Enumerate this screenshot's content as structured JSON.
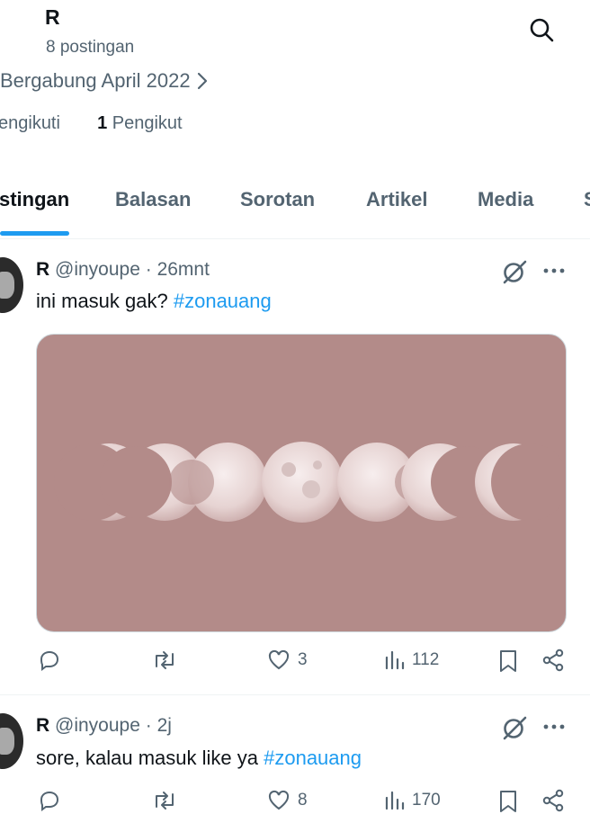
{
  "profile": {
    "name": "R",
    "posts": "8 postingan",
    "joined": "Bergabung April 2022",
    "following_label": "engikuti",
    "followers_count": "1",
    "followers_label": "Pengikut"
  },
  "tabs": [
    {
      "label": "stingan",
      "active": true
    },
    {
      "label": "Balasan"
    },
    {
      "label": "Sorotan"
    },
    {
      "label": "Artikel"
    },
    {
      "label": "Media"
    },
    {
      "label": "S"
    }
  ],
  "tweets": [
    {
      "name": "R",
      "handle": "@inyoupe",
      "time": "· 26mnt",
      "text": "ini masuk gak? ",
      "hashtag": "#zonauang",
      "likes": "3",
      "views": "112"
    },
    {
      "name": "R",
      "handle": "@inyoupe",
      "time": "· 2j",
      "text": "sore, kalau masuk like ya ",
      "hashtag": "#zonauang",
      "likes": "8",
      "views": "170"
    }
  ],
  "colors": {
    "accent": "#1d9bf0",
    "media_bg": "#b38b89",
    "text_secondary": "#536471"
  }
}
